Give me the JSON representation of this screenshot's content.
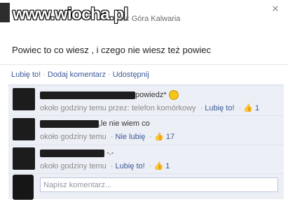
{
  "header": {
    "watermark": "www.wiocha.pl",
    "location": "żu: Góra Kalwaria",
    "close": "✕"
  },
  "post": {
    "text": "Powiec to co wiesz , i czego nie wiesz też powiec"
  },
  "actions": {
    "like": "Lubię to!",
    "comment": "Dodaj komentarz",
    "share": "Udostępnij",
    "separator": "·"
  },
  "comments": [
    {
      "text": "powiedz*",
      "emoji_name": "smiley-icon",
      "time": "około godziny temu przez: telefon komórkowy",
      "action": "Lubię to!",
      "likes": "1"
    },
    {
      "text": ",le nie wiem co",
      "time": "około godziny temu",
      "action": "Nie lubię",
      "likes": "17"
    },
    {
      "text": "-.-",
      "time": "około godziny temu",
      "action": "Lubię to!",
      "likes": "1"
    }
  ],
  "composer": {
    "placeholder": "Napisz komentarz..."
  },
  "colors": {
    "link": "#3b5998",
    "panel": "#eceff5",
    "meta": "#8a8a8a"
  }
}
